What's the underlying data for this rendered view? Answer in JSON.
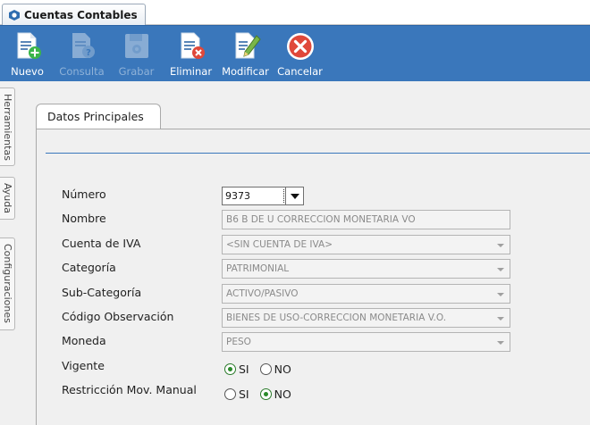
{
  "window": {
    "tab_title": "Cuentas Contables"
  },
  "toolbar": {
    "buttons": [
      {
        "label": "Nuevo",
        "icon": "new-document-icon",
        "enabled": true
      },
      {
        "label": "Consulta",
        "icon": "query-document-icon",
        "enabled": false
      },
      {
        "label": "Grabar",
        "icon": "save-disk-icon",
        "enabled": false
      },
      {
        "label": "Eliminar",
        "icon": "delete-document-icon",
        "enabled": true
      },
      {
        "label": "Modificar",
        "icon": "edit-document-icon",
        "enabled": true
      },
      {
        "label": "Cancelar",
        "icon": "cancel-circle-icon",
        "enabled": true
      }
    ]
  },
  "side_tabs": [
    "Herramientas",
    "Ayuda",
    "Configuraciones"
  ],
  "page_tab": "Datos Principales",
  "form": {
    "numero": {
      "label": "Número",
      "value": "9373"
    },
    "nombre": {
      "label": "Nombre",
      "value": "B6 B DE U CORRECCION MONETARIA VO"
    },
    "cuenta_iva": {
      "label": "Cuenta de IVA",
      "value": "<SIN CUENTA DE IVA>"
    },
    "categoria": {
      "label": "Categoría",
      "value": "PATRIMONIAL"
    },
    "subcategoria": {
      "label": "Sub-Categoría",
      "value": "ACTIVO/PASIVO"
    },
    "codigo_obs": {
      "label": "Código Observación",
      "value": "BIENES DE USO-CORRECCION MONETARIA V.O."
    },
    "moneda": {
      "label": "Moneda",
      "value": "PESO"
    },
    "vigente": {
      "label": "Vigente",
      "options": [
        "SI",
        "NO"
      ],
      "selected": "SI"
    },
    "restriccion": {
      "label": "Restricción Mov. Manual",
      "options": [
        "SI",
        "NO"
      ],
      "selected": "NO"
    }
  },
  "colors": {
    "toolbar": "#3a77bb",
    "accent_line": "#3a77bb",
    "radio_selected": "#2a8a2a"
  }
}
